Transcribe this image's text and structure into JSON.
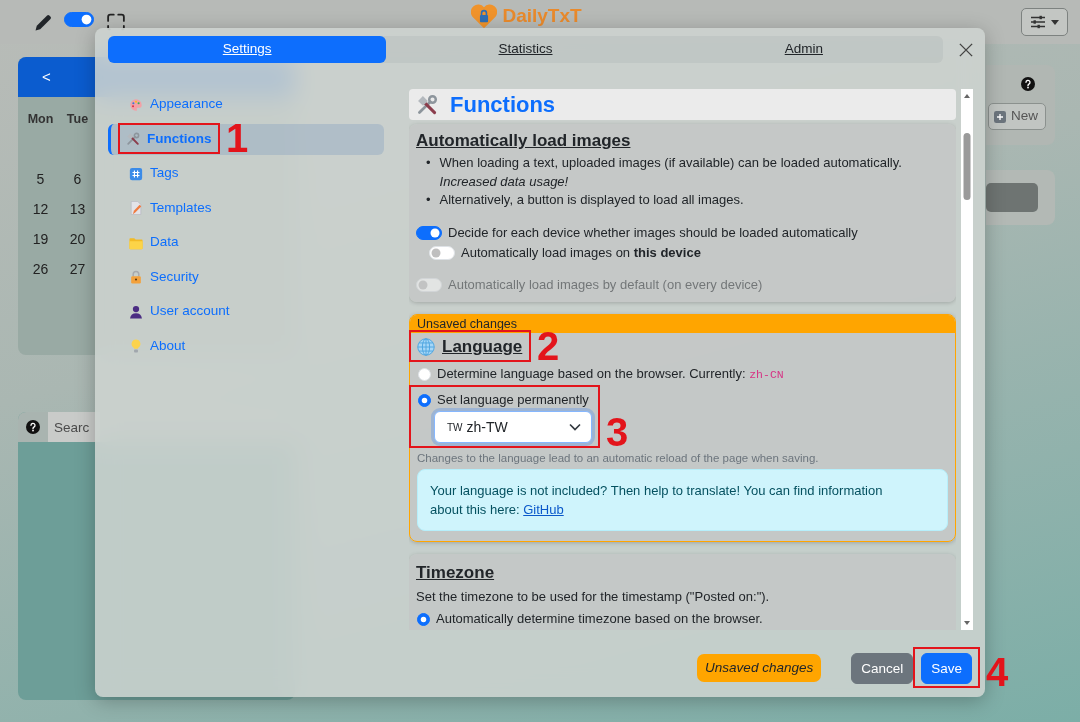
{
  "top_bar": {
    "switch": {
      "on": true
    },
    "logo": "DailyTxT"
  },
  "calendar": {
    "prev": "<",
    "weekdays": [
      "Mon",
      "Tue"
    ],
    "weeks": [
      [
        "5",
        "6"
      ],
      [
        "12",
        "13"
      ],
      [
        "19",
        "20"
      ],
      [
        "26",
        "27"
      ]
    ]
  },
  "search_panel": {
    "placeholder": "Searc"
  },
  "side_panel": {
    "new_button": "New"
  },
  "settings": {
    "tabs": [
      {
        "label": "Settings",
        "selected": true
      },
      {
        "label": "Statistics",
        "selected": false
      },
      {
        "label": "Admin",
        "selected": false
      }
    ],
    "nav": [
      {
        "label": "Appearance",
        "selected": false
      },
      {
        "label": "Functions",
        "selected": true,
        "annotation": "1"
      },
      {
        "label": "Tags",
        "selected": false
      },
      {
        "label": "Templates",
        "selected": false
      },
      {
        "label": "Data",
        "selected": false
      },
      {
        "label": "Security",
        "selected": false
      },
      {
        "label": "User account",
        "selected": false
      },
      {
        "label": "About",
        "selected": false
      }
    ],
    "page_title": "Functions",
    "sections": [
      {
        "kind": "switches",
        "title": "Automatically load images",
        "bullets": [
          {
            "marker": "•",
            "text": "When loading a text, uploaded images (if available) can be loaded automatically. *Increased data usage!*"
          },
          {
            "marker": "•",
            "text": "Alternatively, a button is displayed to load all images."
          }
        ],
        "switches": [
          {
            "label": "Decide for each device whether images should be loaded automatically",
            "on": true,
            "disabled": false,
            "children": [
              {
                "label": "Automatically load images on **this device**",
                "on": false,
                "disabled": false
              }
            ]
          },
          {
            "label": "Automatically load images by default (on every device)",
            "on": false,
            "disabled": true
          }
        ]
      },
      {
        "kind": "radios",
        "unsaved_label": "Unsaved changes",
        "title": "Language",
        "annotation": "2",
        "options": [
          {
            "label": "Determine language based on the browser. Currently:",
            "code": "zh-CN",
            "selected": false
          },
          {
            "label": "Set language permanently",
            "selected": true,
            "annotation": "3",
            "select": {
              "flag": "TW",
              "value": "zh-TW"
            }
          }
        ],
        "hint": "Changes to the language lead to an automatic reload of the page when saving.",
        "info": {
          "text": "Your language is not included? Then help to translate! You can find information about this here:",
          "link": "GitHub"
        }
      },
      {
        "kind": "radios",
        "title": "Timezone",
        "description": "Set the timezone to be used for the timestamp (\"Posted on:\").",
        "options": [
          {
            "label": "Automatically determine timezone based on the browser.",
            "selected": true
          }
        ]
      }
    ],
    "footer": {
      "status": "Unsaved changes",
      "buttons": [
        {
          "label": "Cancel",
          "kind": "secondary"
        },
        {
          "label": "Save",
          "kind": "primary",
          "annotation": "4"
        }
      ]
    }
  }
}
